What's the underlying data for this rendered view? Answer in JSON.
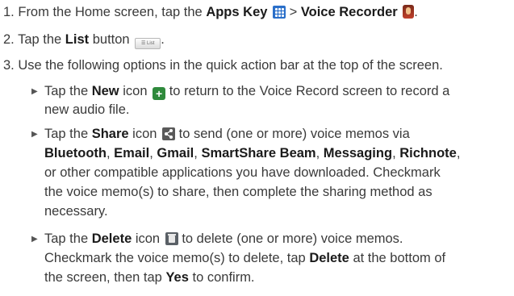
{
  "steps": {
    "s1": {
      "num": "1.",
      "pre": "From the Home screen, tap the",
      "bold1": "Apps Key",
      "sep": ">",
      "bold2": "Voice Recorder",
      "end": "."
    },
    "s2": {
      "num": "2.",
      "pre": "Tap the",
      "bold1": "List",
      "mid": "button",
      "list_icon_text": "☰ List",
      "end": "."
    },
    "s3": {
      "num": "3.",
      "text": "Use the following options in the quick action bar at the top of the screen."
    }
  },
  "bullets": {
    "b1": {
      "pre": "Tap the",
      "bold": "New",
      "post1": "icon",
      "post2": "to return to the Voice Record screen to record a",
      "l2": "new audio file."
    },
    "b2": {
      "pre": "Tap the",
      "bold": "Share",
      "post1": "icon",
      "post2": "to send (one or more) voice memos via",
      "bt": "Bluetooth",
      "c1": ",",
      "email": "Email",
      "c2": ",",
      "gmail": "Gmail",
      "c3": ",",
      "ssb": "SmartShare Beam",
      "c4": ",",
      "msg": "Messaging",
      "c5": ",",
      "rich": "Richnote",
      "c6": ",",
      "l3": "or other compatible applications you have downloaded. Checkmark",
      "l4": "the voice memo(s) to share, then complete the sharing method as",
      "l5": "necessary."
    },
    "b3": {
      "pre": "Tap the",
      "bold": "Delete",
      "post1": "icon",
      "post2": "to delete (one or more) voice memos.",
      "l2": "Checkmark the voice memo(s) to delete, tap",
      "del2": "Delete",
      "l2b": "at the bottom of",
      "l3a": "the screen, then tap",
      "yes": "Yes",
      "l3b": "to confirm."
    }
  }
}
